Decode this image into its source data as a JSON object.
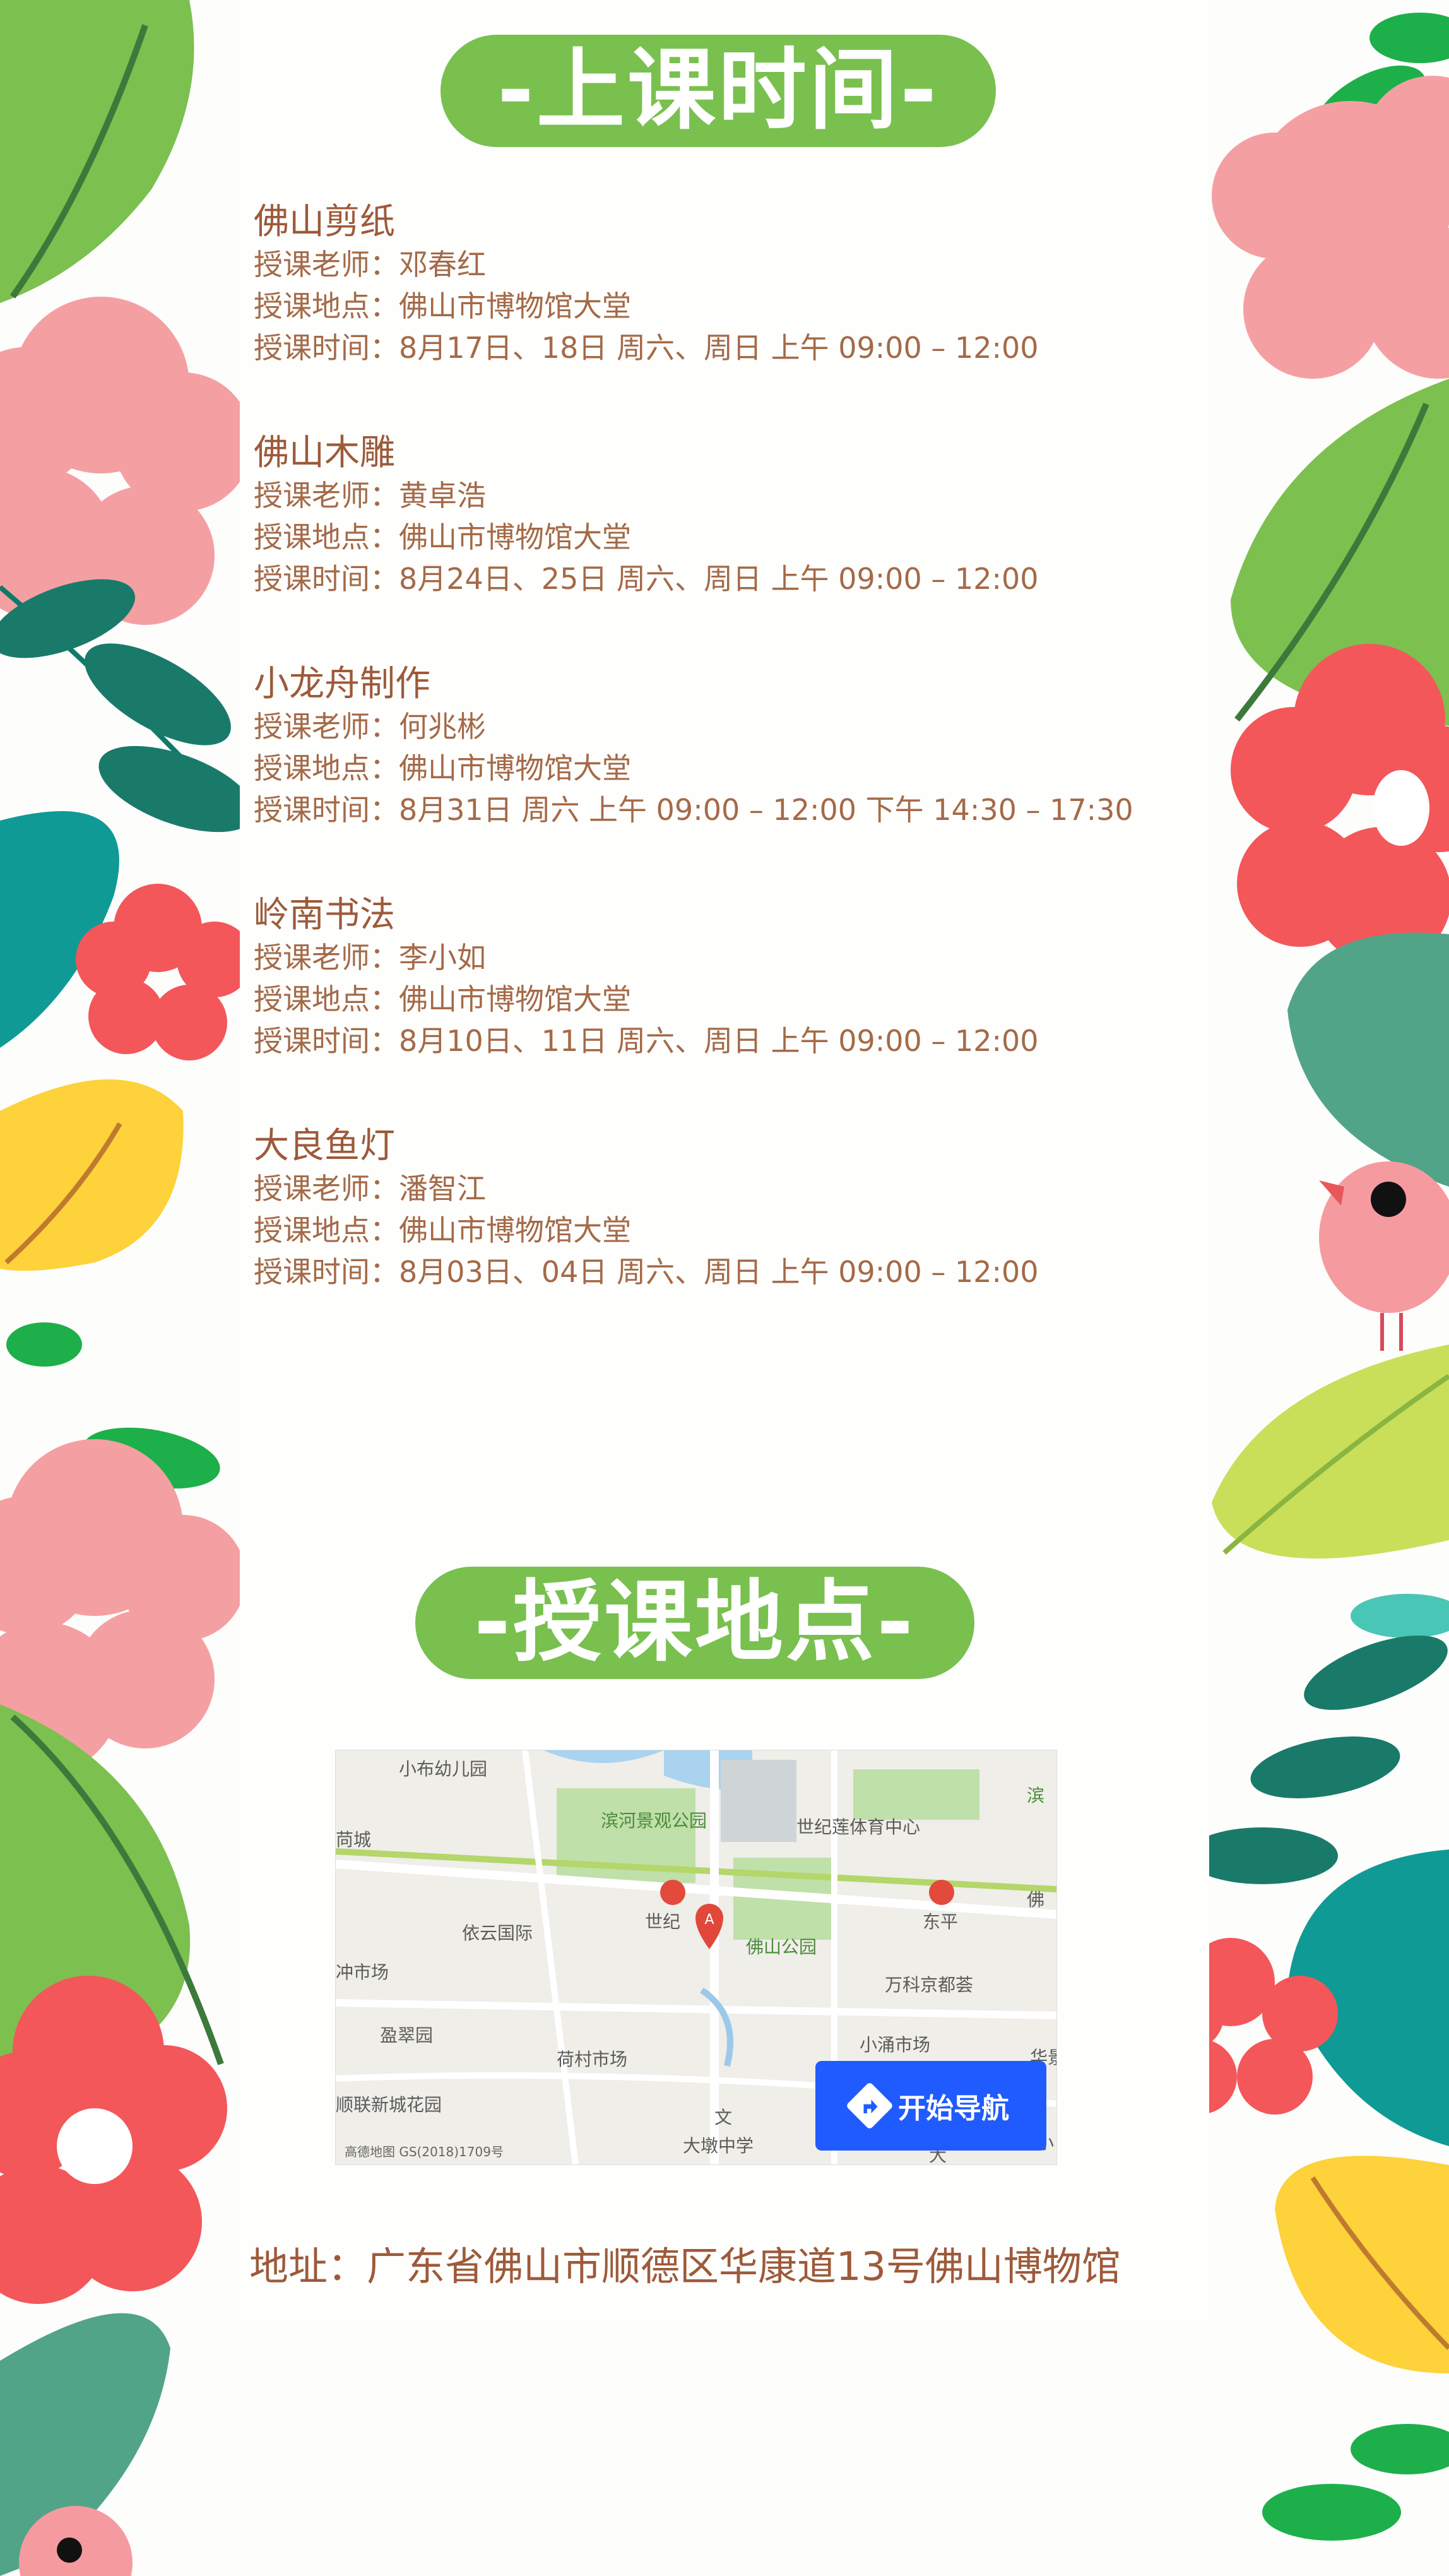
{
  "schedule_section": {
    "title": "-上课时间-",
    "courses": [
      {
        "name": "佛山剪纸",
        "teacher": "授课老师：邓春红",
        "location": "授课地点：佛山市博物馆大堂",
        "time": "授课时间：8月17日、18日    周六、周日  上午  09:00  –  12:00"
      },
      {
        "name": "佛山木雕",
        "teacher": "授课老师：黄卓浩",
        "location": "授课地点：佛山市博物馆大堂",
        "time": "授课时间：8月24日、25日    周六、周日  上午  09:00  –  12:00"
      },
      {
        "name": "小龙舟制作",
        "teacher": "授课老师：何兆彬",
        "location": "授课地点：佛山市博物馆大堂",
        "time": "授课时间：8月31日    周六  上午  09:00  –  12:00  下午  14:30  –  17:30"
      },
      {
        "name": "岭南书法",
        "teacher": "授课老师：李小如",
        "location": "授课地点：佛山市博物馆大堂",
        "time": "授课时间：8月10日、11日     周六、周日  上午  09:00  –  12:00"
      },
      {
        "name": "大良鱼灯",
        "teacher": "授课老师：潘智江",
        "location": "授课地点：佛山市博物馆大堂",
        "time": "授课时间：8月03日、04日     周六、周日  上午  09:00  –  12:00"
      }
    ]
  },
  "location_section": {
    "title": "-授课地点-",
    "map": {
      "labels": [
        "小布幼儿园",
        "滨河景观公园",
        "世纪莲体育中心",
        "滨",
        "苘城",
        "依云国际",
        "世纪",
        "佛山公园",
        "东平",
        "佛",
        "冲市场",
        "万科京都荟",
        "盈翠园",
        "荷村市场",
        "小涌市场",
        "华景",
        "顺联新城花园",
        "文",
        "大墩中学",
        "小",
        "大"
      ],
      "copyright": "高德地图  GS(2018)1709号",
      "nav_button": "开始导航"
    },
    "address": "地址：广东省佛山市顺德区华康道13号佛山博物馆"
  },
  "colors": {
    "accent": "#79c04f",
    "text": "#9d5a3a",
    "nav": "#1f5bff"
  }
}
